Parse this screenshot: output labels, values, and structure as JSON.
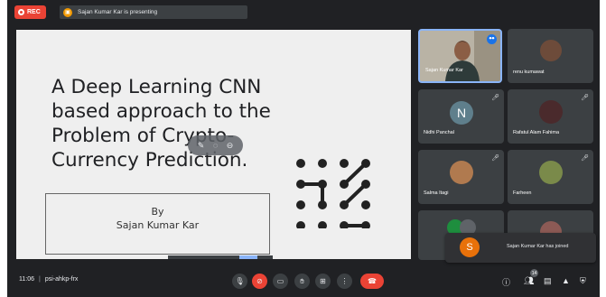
{
  "top_bar": {
    "rec_label": "REC",
    "presenting_text": "Sajan Kumar Kar is presenting"
  },
  "slide": {
    "title": "A Deep Learning CNN based approach to the Problem of Crypto-Currency Prediction.",
    "by_label": "By",
    "author": "Sajan Kumar Kar"
  },
  "participants": [
    {
      "name": "Sajan Kumar Kar",
      "speaking": true
    },
    {
      "name": "renu kumawat"
    },
    {
      "name": "Nidhi Panchal",
      "initial": "N"
    },
    {
      "name": "Rafatul Alam Fahima"
    },
    {
      "name": "Salma Itagi"
    },
    {
      "name": "Farheen"
    }
  ],
  "toast": {
    "initial": "S",
    "text": "Sajan Kumar Kar has joined"
  },
  "toolbar": {
    "time": "11:06",
    "separator": "|",
    "meeting_code": "psi-ahkp-frx",
    "people_count": "14"
  },
  "colors": {
    "background": "#202124",
    "tile": "#3c4043",
    "accent_red": "#ea4335",
    "accent_blue": "#8ab4f8"
  }
}
